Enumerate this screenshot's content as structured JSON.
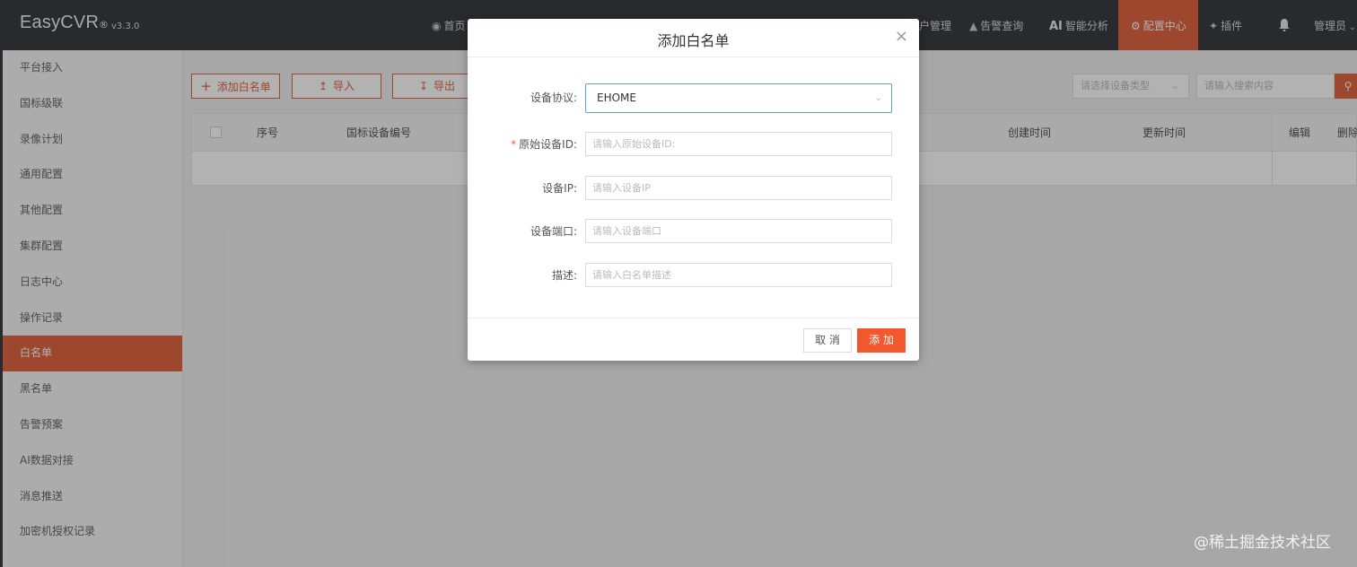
{
  "header": {
    "brand": "EasyCVR",
    "reg_mark": "®",
    "version": "v3.3.0",
    "nav": [
      {
        "label": "首页",
        "icon": "dashboard-icon"
      },
      {
        "label": "户管理",
        "icon": ""
      },
      {
        "label": "告警查询",
        "icon": "alarm-icon"
      },
      {
        "label": "智能分析",
        "icon": "ai-icon",
        "prefix": "AI"
      },
      {
        "label": "配置中心",
        "icon": "gear-icon",
        "active": true
      },
      {
        "label": "插件",
        "icon": "puzzle-icon"
      }
    ],
    "admin": "管理员",
    "accent": "#e06643"
  },
  "sidebar": {
    "items": [
      {
        "label": "平台接入"
      },
      {
        "label": "国标级联"
      },
      {
        "label": "录像计划"
      },
      {
        "label": "通用配置"
      },
      {
        "label": "其他配置"
      },
      {
        "label": "集群配置"
      },
      {
        "label": "日志中心"
      },
      {
        "label": "操作记录"
      },
      {
        "label": "白名单",
        "active": true
      },
      {
        "label": "黑名单"
      },
      {
        "label": "告警预案"
      },
      {
        "label": "AI数据对接"
      },
      {
        "label": "消息推送"
      },
      {
        "label": "加密机授权记录"
      }
    ]
  },
  "toolbar": {
    "add_label": "添加白名单",
    "import_label": "导入",
    "export_label": "导出",
    "device_type_placeholder": "请选择设备类型",
    "search_placeholder": "请输入搜索内容"
  },
  "table": {
    "columns": [
      "序号",
      "国标设备编号",
      "创建时间",
      "更新时间",
      "编辑",
      "删除"
    ]
  },
  "modal": {
    "title": "添加白名单",
    "close": "×",
    "protocol_label": "设备协议:",
    "protocol_value": "EHOME",
    "device_id_label": "原始设备ID:",
    "device_id_placeholder": "请输入原始设备ID:",
    "device_ip_label": "设备IP:",
    "device_ip_placeholder": "请输入设备IP",
    "device_port_label": "设备端口:",
    "device_port_placeholder": "请输入设备端口",
    "desc_label": "描述:",
    "desc_placeholder": "请输入白名单描述",
    "cancel_label": "取 消",
    "add_label": "添 加"
  },
  "watermark": "@稀土掘金技术社区"
}
